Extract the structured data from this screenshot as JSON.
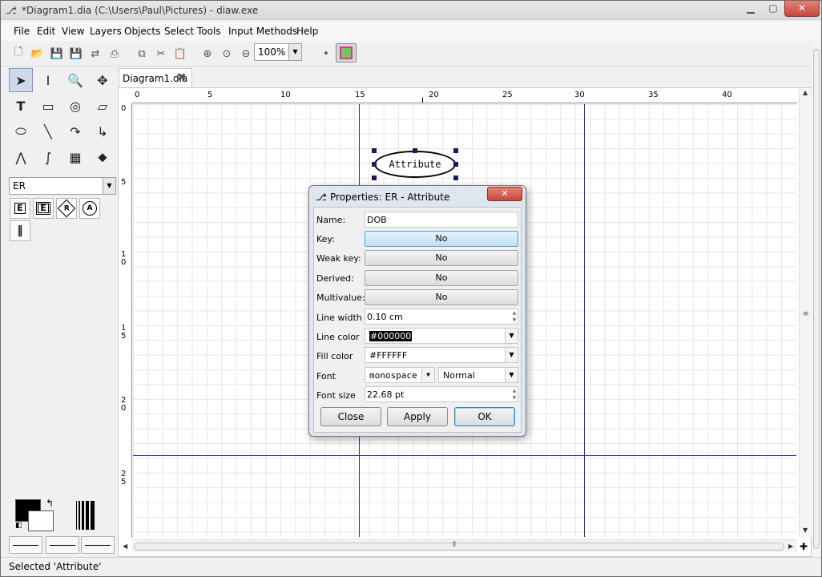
{
  "window": {
    "title": "*Diagram1.dia (C:\\Users\\Paul\\Pictures) - diaw.exe"
  },
  "menu": [
    "File",
    "Edit",
    "View",
    "Layers",
    "Objects",
    "Select",
    "Tools",
    "Input Methods",
    "Help"
  ],
  "toolbar": {
    "zoom_value": "100%"
  },
  "toolbox": {
    "sheet_selected": "ER"
  },
  "tab": {
    "label": "Diagram1.dia",
    "close_glyph": "✖"
  },
  "ruler": {
    "top_labels": [
      "0",
      "5",
      "10",
      "15",
      "20",
      "25",
      "30",
      "35",
      "40"
    ],
    "left_labels": [
      "0",
      "5",
      "1\n0",
      "1\n5",
      "2\n0",
      "2\n5"
    ]
  },
  "canvas": {
    "attribute_text": "Attribute"
  },
  "dialog": {
    "title": "Properties: ER - Attribute",
    "labels": {
      "name": "Name:",
      "key": "Key:",
      "weak_key": "Weak key:",
      "derived": "Derived:",
      "multivalue": "Multivalue:",
      "line_width": "Line width",
      "line_color": "Line color",
      "fill_color": "Fill color",
      "font": "Font",
      "font_size": "Font size"
    },
    "values": {
      "name": "DOB",
      "key": "No",
      "weak_key": "No",
      "derived": "No",
      "multivalue": "No",
      "line_width": "0.10 cm",
      "line_color": "#000000",
      "fill_color": "#FFFFFF",
      "font_family": "monospace",
      "font_style": "Normal",
      "font_size": "22.68 pt"
    },
    "buttons": {
      "close": "Close",
      "apply": "Apply",
      "ok": "OK"
    }
  },
  "status": {
    "text": "Selected 'Attribute'"
  }
}
